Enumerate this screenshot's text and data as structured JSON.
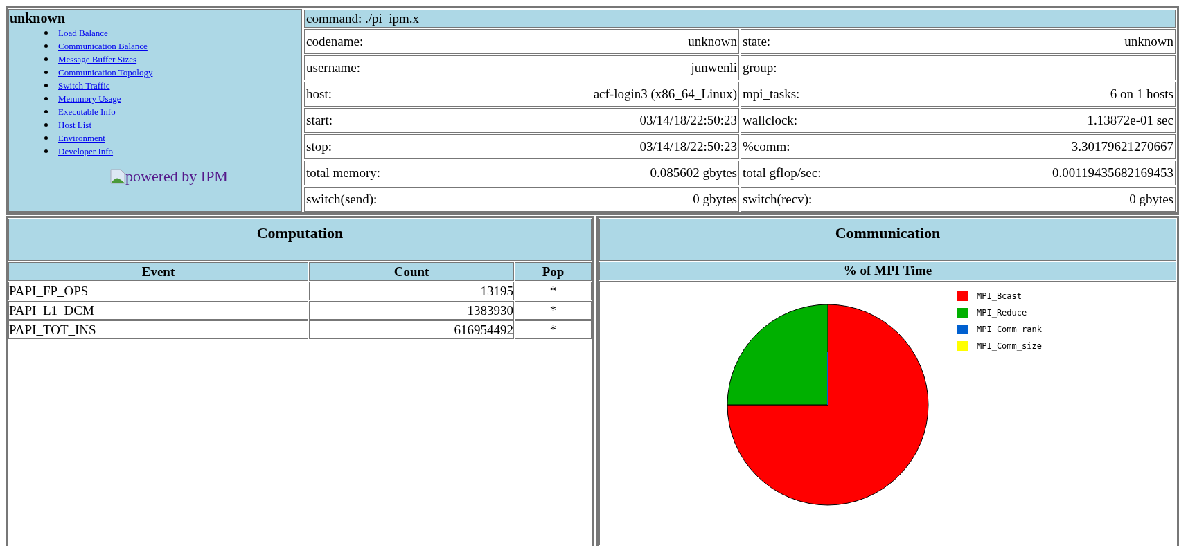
{
  "sidebar": {
    "title": "unknown",
    "links": [
      "Load Balance",
      "Communication Balance",
      "Message Buffer Sizes",
      "Communication Topology",
      "Switch Traffic",
      "Memmory Usage",
      "Executable Info",
      "Host List",
      "Environment",
      "Developer Info"
    ],
    "powered_by": "powered by IPM"
  },
  "summary": {
    "command": "command: ./pi_ipm.x",
    "rows": [
      {
        "label_1": "codename:",
        "value_1": "unknown",
        "label_2": "state:",
        "value_2": "unknown"
      },
      {
        "label_1": "username:",
        "value_1": "junwenli",
        "label_2": "group:",
        "value_2": ""
      },
      {
        "label_1": "host:",
        "value_1": "acf-login3 (x86_64_Linux)",
        "label_2": "mpi_tasks:",
        "value_2": "6 on 1 hosts"
      },
      {
        "label_1": "start:",
        "value_1": "03/14/18/22:50:23",
        "label_2": "wallclock:",
        "value_2": "1.13872e-01 sec"
      },
      {
        "label_1": "stop:",
        "value_1": "03/14/18/22:50:23",
        "label_2": "%comm:",
        "value_2": "3.30179621270667"
      },
      {
        "label_1": "total memory:",
        "value_1": "0.085602 gbytes",
        "label_2": "total gflop/sec:",
        "value_2": "0.00119435682169453"
      },
      {
        "label_1": "switch(send):",
        "value_1": "0 gbytes",
        "label_2": "switch(recv):",
        "value_2": "0 gbytes"
      }
    ]
  },
  "computation": {
    "title": "Computation",
    "columns": [
      "Event",
      "Count",
      "Pop"
    ],
    "rows": [
      [
        "PAPI_FP_OPS",
        "13195",
        "*"
      ],
      [
        "PAPI_L1_DCM",
        "1383930",
        "*"
      ],
      [
        "PAPI_TOT_INS",
        "616954492",
        "*"
      ]
    ]
  },
  "communication": {
    "title": "Communication",
    "subtitle": "% of MPI Time",
    "legend": [
      {
        "label": "MPI_Bcast",
        "color": "#ff0000"
      },
      {
        "label": "MPI_Reduce",
        "color": "#00b000"
      },
      {
        "label": "MPI_Comm_rank",
        "color": "#0060d0"
      },
      {
        "label": "MPI_Comm_size",
        "color": "#ffff00"
      }
    ]
  }
}
